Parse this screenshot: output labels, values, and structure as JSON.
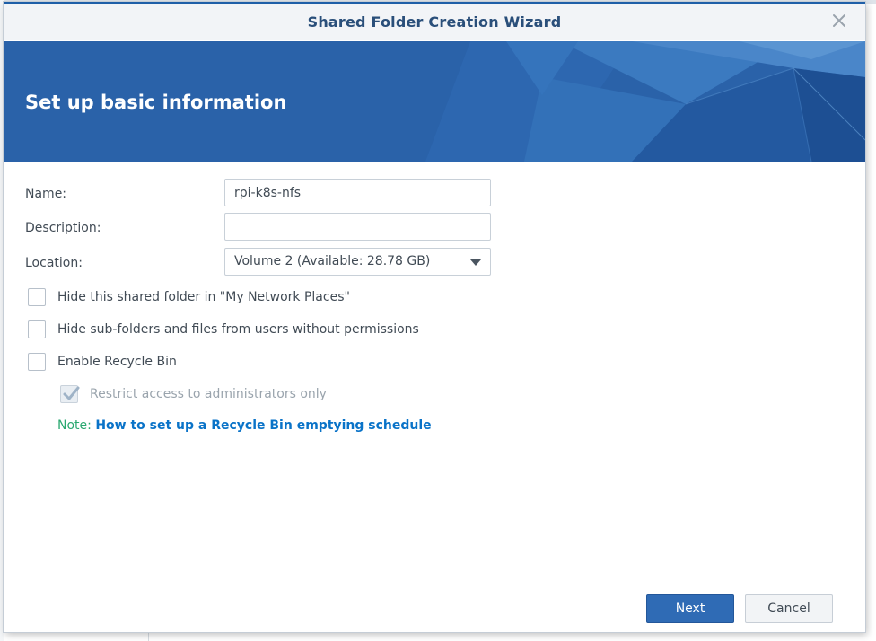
{
  "dialog": {
    "title": "Shared Folder Creation Wizard",
    "banner_title": "Set up basic information"
  },
  "form": {
    "name_label": "Name:",
    "name_value": "rpi-k8s-nfs",
    "description_label": "Description:",
    "description_value": "",
    "location_label": "Location:",
    "location_value": "Volume 2 (Available: 28.78 GB)",
    "hide_in_network_places": {
      "label": "Hide this shared folder in \"My Network Places\"",
      "checked": false
    },
    "hide_subfolders": {
      "label": "Hide sub-folders and files from users without permissions",
      "checked": false
    },
    "enable_recycle_bin": {
      "label": "Enable Recycle Bin",
      "checked": false
    },
    "restrict_admins": {
      "label": "Restrict access to administrators only",
      "checked": true,
      "disabled": true
    },
    "note_prefix": "Note:",
    "note_link": "How to set up a Recycle Bin emptying schedule"
  },
  "buttons": {
    "next": "Next",
    "cancel": "Cancel"
  },
  "colors": {
    "banner": "#2a62a9",
    "primary_button": "#2f6bb5",
    "link": "#0a73c8",
    "note_prefix": "#2aa870"
  }
}
